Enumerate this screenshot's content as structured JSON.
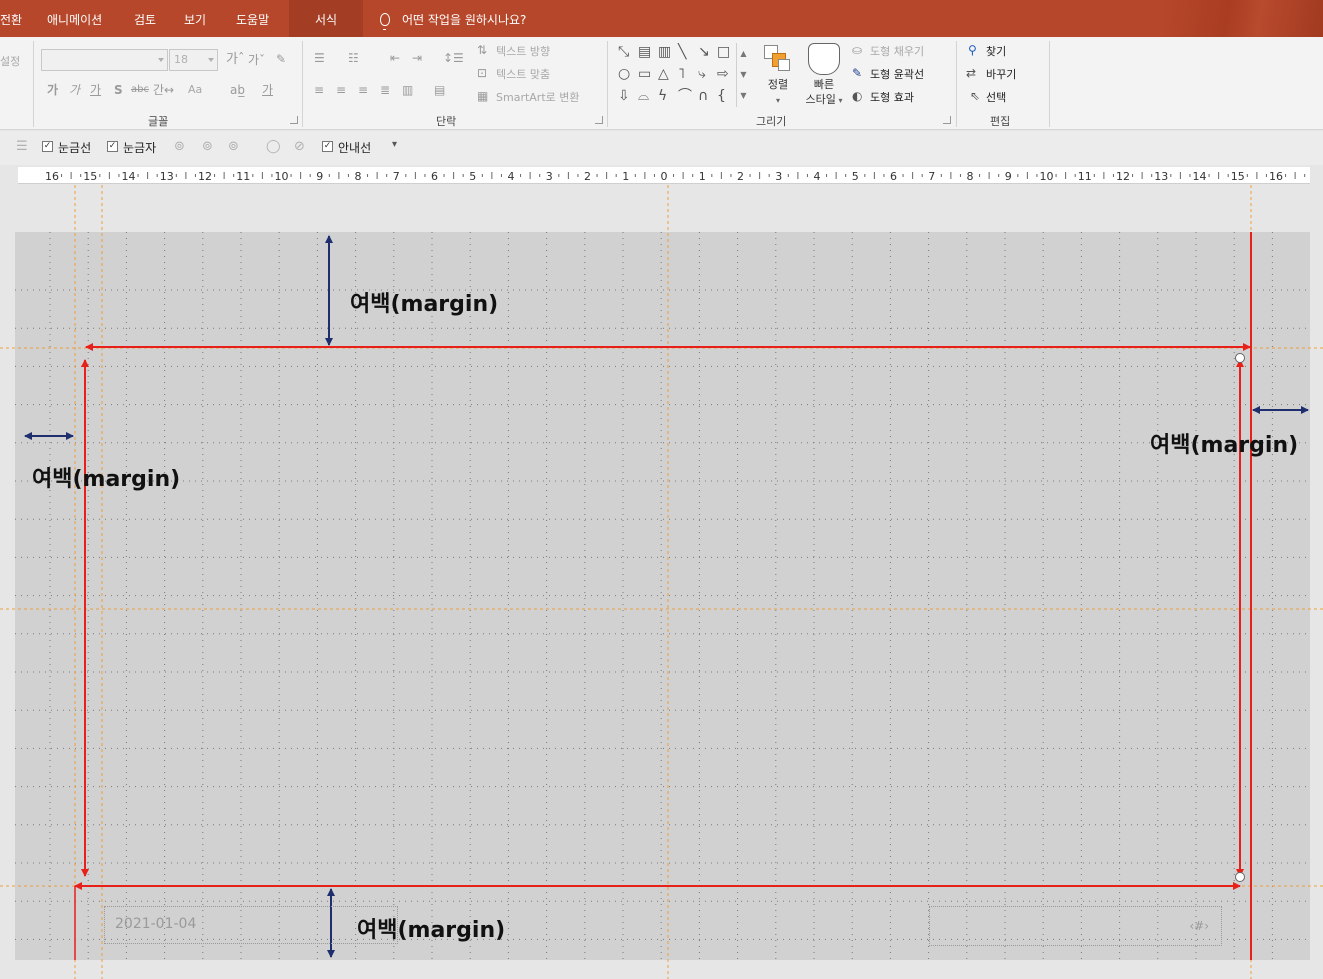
{
  "menu": {
    "tabs": [
      {
        "label": "전환"
      },
      {
        "label": "애니메이션"
      },
      {
        "label": "검토"
      },
      {
        "label": "보기"
      },
      {
        "label": "도움말"
      },
      {
        "label": "서식"
      }
    ],
    "active_tab": "서식",
    "tell_me": "어떤 작업을 원하시나요?"
  },
  "ribbon": {
    "font_group": {
      "label": "글꼴",
      "left_stub": "설정",
      "font_name": "",
      "font_size": "18",
      "case_button": "Aa"
    },
    "paragraph_group": {
      "label": "단락",
      "text_direction": "텍스트 방향",
      "align_text": "텍스트 맞춤",
      "smartart": "SmartArt로 변환"
    },
    "drawing_group": {
      "label": "그리기",
      "arrange": "정렬",
      "quick_styles_line1": "빠른",
      "quick_styles_line2": "스타일",
      "shape_fill": "도형 채우기",
      "shape_outline": "도형 윤곽선",
      "shape_effects": "도형 효과"
    },
    "editing_group": {
      "label": "편집",
      "find": "찾기",
      "replace": "바꾸기",
      "select": "선택"
    }
  },
  "toolbar": {
    "gridlines": {
      "label": "눈금선",
      "checked": true
    },
    "ruler": {
      "label": "눈금자",
      "checked": true
    },
    "guides": {
      "label": "안내선",
      "checked": true
    }
  },
  "ruler_ticks": [
    "16",
    "15",
    "14",
    "13",
    "12",
    "11",
    "10",
    "9",
    "8",
    "7",
    "6",
    "5",
    "4",
    "3",
    "2",
    "1",
    "0",
    "1",
    "2",
    "3",
    "4",
    "5",
    "6",
    "7",
    "8",
    "9",
    "10",
    "11",
    "12",
    "13",
    "14",
    "15",
    "16"
  ],
  "slide": {
    "margin_top": "여백(margin)",
    "margin_left": "여백(margin)",
    "margin_right": "여백(margin)",
    "margin_bottom": "여백(margin)",
    "date_placeholder": "2021-01-04",
    "slide_number_placeholder": "‹#›"
  },
  "colors": {
    "menubar": "#b7472a",
    "margin_line": "#e8201a",
    "margin_arrow": "#1f2f6e",
    "guide": "#f0a040"
  }
}
